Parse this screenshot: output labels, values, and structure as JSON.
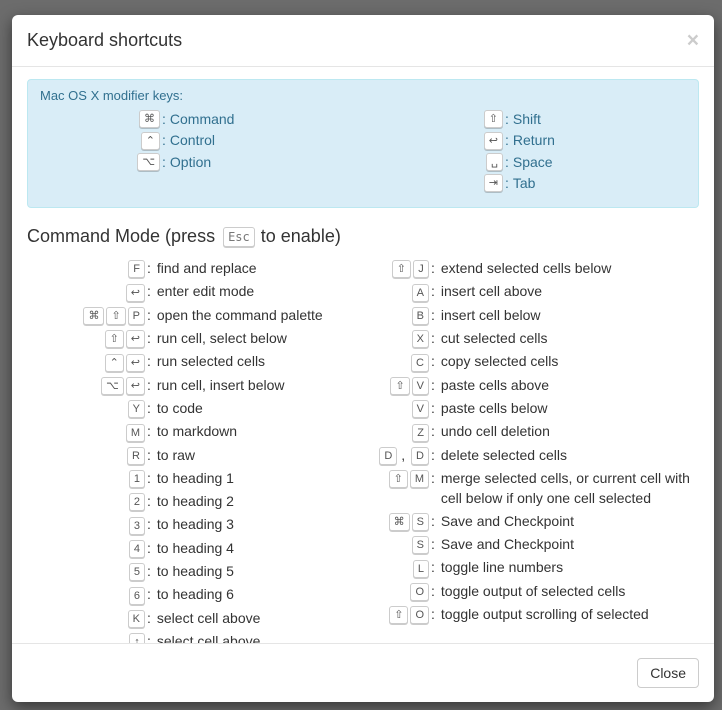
{
  "dialog": {
    "title": "Keyboard shortcuts",
    "close_label": "Close"
  },
  "legend": {
    "title": "Mac OS X modifier keys:",
    "left": [
      {
        "glyph": "⌘",
        "label": "Command"
      },
      {
        "glyph": "⌃",
        "label": "Control"
      },
      {
        "glyph": "⌥",
        "label": "Option"
      }
    ],
    "right": [
      {
        "glyph": "⇧",
        "label": "Shift"
      },
      {
        "glyph": "↩",
        "label": "Return"
      },
      {
        "glyph": "␣",
        "label": "Space"
      },
      {
        "glyph": "⇥",
        "label": "Tab"
      }
    ]
  },
  "section": {
    "heading_pre": "Command Mode (press",
    "heading_key": "Esc",
    "heading_post": "to enable)"
  },
  "shortcuts_left": [
    {
      "keys": [
        "F"
      ],
      "desc": "find and replace"
    },
    {
      "keys": [
        "↩"
      ],
      "desc": "enter edit mode"
    },
    {
      "keys": [
        "⌘",
        "⇧",
        "P"
      ],
      "desc": "open the command palette"
    },
    {
      "keys": [
        "⇧",
        "↩"
      ],
      "desc": "run cell, select below"
    },
    {
      "keys": [
        "⌃",
        "↩"
      ],
      "desc": "run selected cells"
    },
    {
      "keys": [
        "⌥",
        "↩"
      ],
      "desc": "run cell, insert below"
    },
    {
      "keys": [
        "Y"
      ],
      "desc": "to code"
    },
    {
      "keys": [
        "M"
      ],
      "desc": "to markdown"
    },
    {
      "keys": [
        "R"
      ],
      "desc": "to raw"
    },
    {
      "keys": [
        "1"
      ],
      "desc": "to heading 1"
    },
    {
      "keys": [
        "2"
      ],
      "desc": "to heading 2"
    },
    {
      "keys": [
        "3"
      ],
      "desc": "to heading 3"
    },
    {
      "keys": [
        "4"
      ],
      "desc": "to heading 4"
    },
    {
      "keys": [
        "5"
      ],
      "desc": "to heading 5"
    },
    {
      "keys": [
        "6"
      ],
      "desc": "to heading 6"
    },
    {
      "keys": [
        "K"
      ],
      "desc": "select cell above"
    },
    {
      "keys": [
        "↑"
      ],
      "desc": "select cell above"
    }
  ],
  "shortcuts_right": [
    {
      "keys": [
        "⇧",
        "J"
      ],
      "desc": "extend selected cells below"
    },
    {
      "keys": [
        "A"
      ],
      "desc": "insert cell above"
    },
    {
      "keys": [
        "B"
      ],
      "desc": "insert cell below"
    },
    {
      "keys": [
        "X"
      ],
      "desc": "cut selected cells"
    },
    {
      "keys": [
        "C"
      ],
      "desc": "copy selected cells"
    },
    {
      "keys": [
        "⇧",
        "V"
      ],
      "desc": "paste cells above"
    },
    {
      "keys": [
        "V"
      ],
      "desc": "paste cells below"
    },
    {
      "keys": [
        "Z"
      ],
      "desc": "undo cell deletion"
    },
    {
      "keys": [
        "D",
        "D"
      ],
      "sep": ",",
      "desc": "delete selected cells"
    },
    {
      "keys": [
        "⇧",
        "M"
      ],
      "desc": "merge selected cells, or current cell with cell below if only one cell selected"
    },
    {
      "keys": [
        "⌘",
        "S"
      ],
      "desc": "Save and Checkpoint"
    },
    {
      "keys": [
        "S"
      ],
      "desc": "Save and Checkpoint"
    },
    {
      "keys": [
        "L"
      ],
      "desc": "toggle line numbers"
    },
    {
      "keys": [
        "O"
      ],
      "desc": "toggle output of selected cells"
    },
    {
      "keys": [
        "⇧",
        "O"
      ],
      "desc": "toggle output scrolling of selected"
    }
  ]
}
